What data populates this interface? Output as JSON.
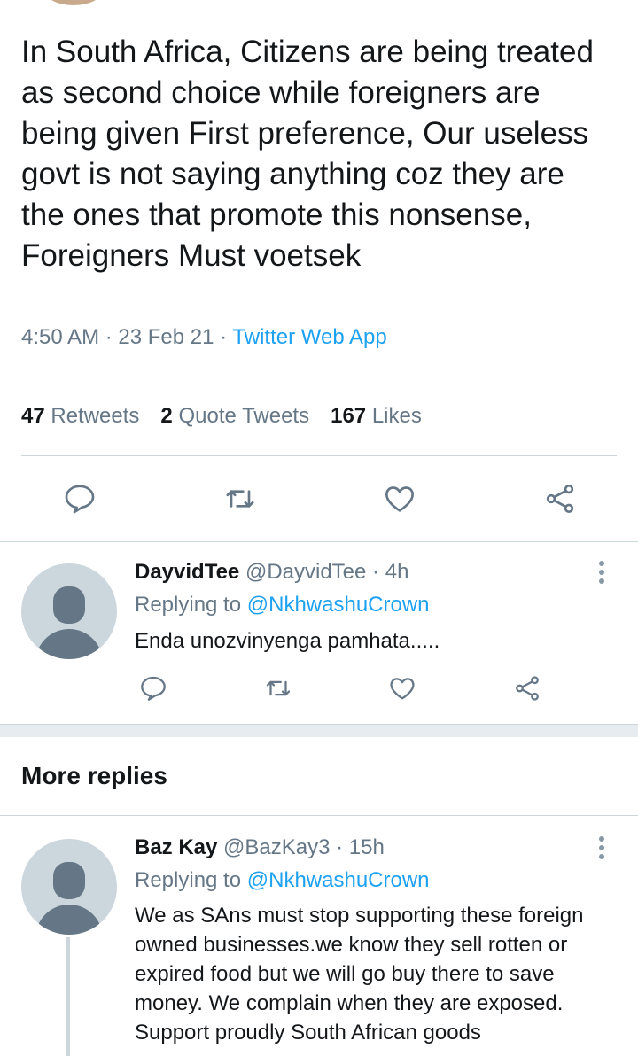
{
  "tweet": {
    "text": "In South Africa, Citizens are being treated as second choice while foreigners are being given First preference, Our useless govt is not saying anything coz they are the ones that promote this nonsense, Foreigners Must voetsek",
    "time": "4:50 AM",
    "date": "23 Feb 21",
    "source": "Twitter Web App",
    "stats": {
      "retweets_count": "47",
      "retweets_label": "Retweets",
      "quotes_count": "2",
      "quotes_label": "Quote Tweets",
      "likes_count": "167",
      "likes_label": "Likes"
    }
  },
  "replies": [
    {
      "name": "DayvidTee",
      "handle": "@DayvidTee",
      "age": "4h",
      "replying_prefix": "Replying to",
      "replying_handle": "@NkhwashuCrown",
      "text": "Enda unozvinyenga pamhata....."
    }
  ],
  "more_replies": {
    "title": "More replies",
    "items": [
      {
        "name": "Baz Kay",
        "handle": "@BazKay3",
        "age": "15h",
        "replying_prefix": "Replying to",
        "replying_handle": "@NkhwashuCrown",
        "text": "We as SAns must stop supporting these foreign owned businesses.we know they sell rotten or expired food  but we will go buy there to save money. We complain when they are exposed. Support proudly South African goods"
      }
    ]
  },
  "separator": "·",
  "icons": [
    "reply-icon",
    "retweet-icon",
    "like-icon",
    "share-icon",
    "more-icon"
  ],
  "colors": {
    "link": "#1da1f2",
    "icon": "#657786",
    "muted": "#657786"
  }
}
